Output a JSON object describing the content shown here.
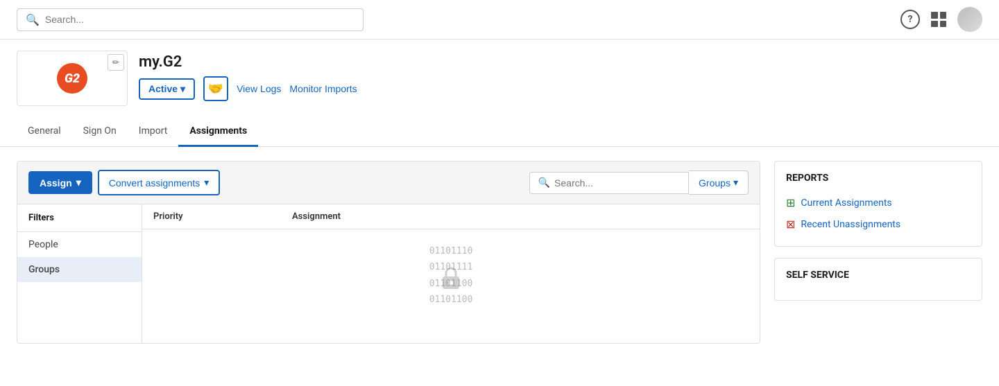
{
  "topbar": {
    "search_placeholder": "Search...",
    "help_label": "?",
    "grid_label": "apps grid"
  },
  "app": {
    "name": "my.G2",
    "logo_alt": "G2 logo",
    "logo_letter": "G2",
    "status_label": "Active",
    "caret": "▾",
    "handshake_icon": "🤝",
    "view_logs_label": "View Logs",
    "monitor_imports_label": "Monitor Imports"
  },
  "tabs": [
    {
      "id": "general",
      "label": "General",
      "active": false
    },
    {
      "id": "sign-on",
      "label": "Sign On",
      "active": false
    },
    {
      "id": "import",
      "label": "Import",
      "active": false
    },
    {
      "id": "assignments",
      "label": "Assignments",
      "active": true
    }
  ],
  "assignments_panel": {
    "assign_label": "Assign",
    "assign_caret": "▾",
    "convert_label": "Convert assignments",
    "convert_caret": "▾",
    "search_placeholder": "Search...",
    "groups_label": "Groups",
    "groups_caret": "▾",
    "filters_header": "Filters",
    "filter_items": [
      {
        "id": "people",
        "label": "People",
        "active": false
      },
      {
        "id": "groups",
        "label": "Groups",
        "active": true
      }
    ],
    "table_headers": {
      "priority": "Priority",
      "assignment": "Assignment"
    },
    "binary_lines": [
      "01101110",
      "01101111",
      "01101100",
      "01101100"
    ]
  },
  "reports": {
    "title": "REPORTS",
    "current_assignments_label": "Current Assignments",
    "recent_unassignments_label": "Recent Unassignments"
  },
  "self_service": {
    "title": "SELF SERVICE"
  }
}
